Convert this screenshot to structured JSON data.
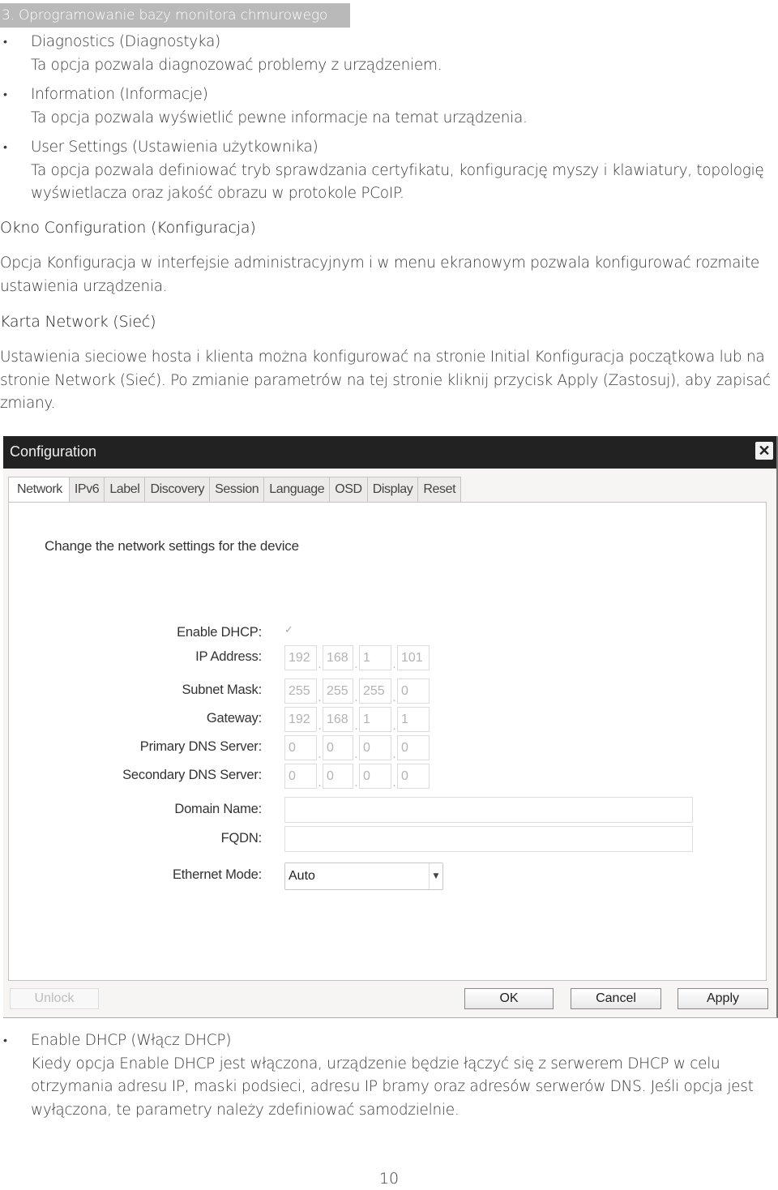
{
  "header": {
    "section_title": "3. Oprogramowanie bazy monitora chmurowego"
  },
  "top_bullets": [
    {
      "title": "Diagnostics (Diagnostyka)",
      "text": "Ta opcja pozwala diagnozować problemy z urządzeniem."
    },
    {
      "title": "Information (Informacje)",
      "text": "Ta opcja pozwala wyświetlić pewne informacje na temat urządzenia."
    },
    {
      "title": "User Settings (Ustawienia użytkownika)",
      "text": "Ta opcja pozwala definiować tryb sprawdzania certyfikatu, konfigurację myszy i klawiatury, topologię wyświetlacza oraz jakość obrazu w protokole PCoIP."
    }
  ],
  "sections": [
    {
      "heading": "Okno Configuration (Konfiguracja)",
      "text": "Opcja Konfiguracja w interfejsie administracyjnym i w menu ekranowym pozwala konfigurować rozmaite ustawienia urządzenia."
    },
    {
      "heading": "Karta Network (Sieć)",
      "text": "Ustawienia sieciowe hosta i klienta można konfigurować na stronie Initial Konfiguracja początkowa lub na stronie Network (Sieć). Po zmianie parametrów na tej stronie kliknij przycisk Apply (Zastosuj), aby zapisać zmiany."
    }
  ],
  "dialog": {
    "title": "Configuration",
    "close_icon": "✕",
    "tabs": [
      {
        "label": "Network",
        "active": true
      },
      {
        "label": "IPv6"
      },
      {
        "label": "Label"
      },
      {
        "label": "Discovery"
      },
      {
        "label": "Session"
      },
      {
        "label": "Language"
      },
      {
        "label": "OSD"
      },
      {
        "label": "Display"
      },
      {
        "label": "Reset"
      }
    ],
    "description": "Change the network settings for the device",
    "fields": {
      "enable_dhcp": {
        "label": "Enable DHCP:",
        "checked": true,
        "check_glyph": "✓"
      },
      "ip_address": {
        "label": "IP Address:",
        "octets": [
          "192",
          "168",
          "1",
          "101"
        ]
      },
      "subnet_mask": {
        "label": "Subnet Mask:",
        "octets": [
          "255",
          "255",
          "255",
          "0"
        ]
      },
      "gateway": {
        "label": "Gateway:",
        "octets": [
          "192",
          "168",
          "1",
          "1"
        ]
      },
      "primary_dns": {
        "label": "Primary DNS Server:",
        "octets": [
          "0",
          "0",
          "0",
          "0"
        ]
      },
      "secondary_dns": {
        "label": "Secondary DNS Server:",
        "octets": [
          "0",
          "0",
          "0",
          "0"
        ]
      },
      "domain_name": {
        "label": "Domain Name:",
        "value": ""
      },
      "fqdn": {
        "label": "FQDN:",
        "value": ""
      },
      "ethernet_mode": {
        "label": "Ethernet Mode:",
        "value": "Auto",
        "arrow": "▼"
      }
    },
    "separator": ".",
    "buttons": {
      "unlock": "Unlock",
      "ok": "OK",
      "cancel": "Cancel",
      "apply": "Apply"
    }
  },
  "bottom_bullet": {
    "title": "Enable DHCP (Włącz DHCP)",
    "text": "Kiedy opcja Enable DHCP jest włączona, urządzenie będzie łączyć się z serwerem DHCP w celu otrzymania adresu IP, maski podsieci, adresu IP bramy oraz adresów serwerów DNS. Jeśli opcja jest wyłączona, te parametry należy zdefiniować samodzielnie."
  },
  "page_number": "10"
}
